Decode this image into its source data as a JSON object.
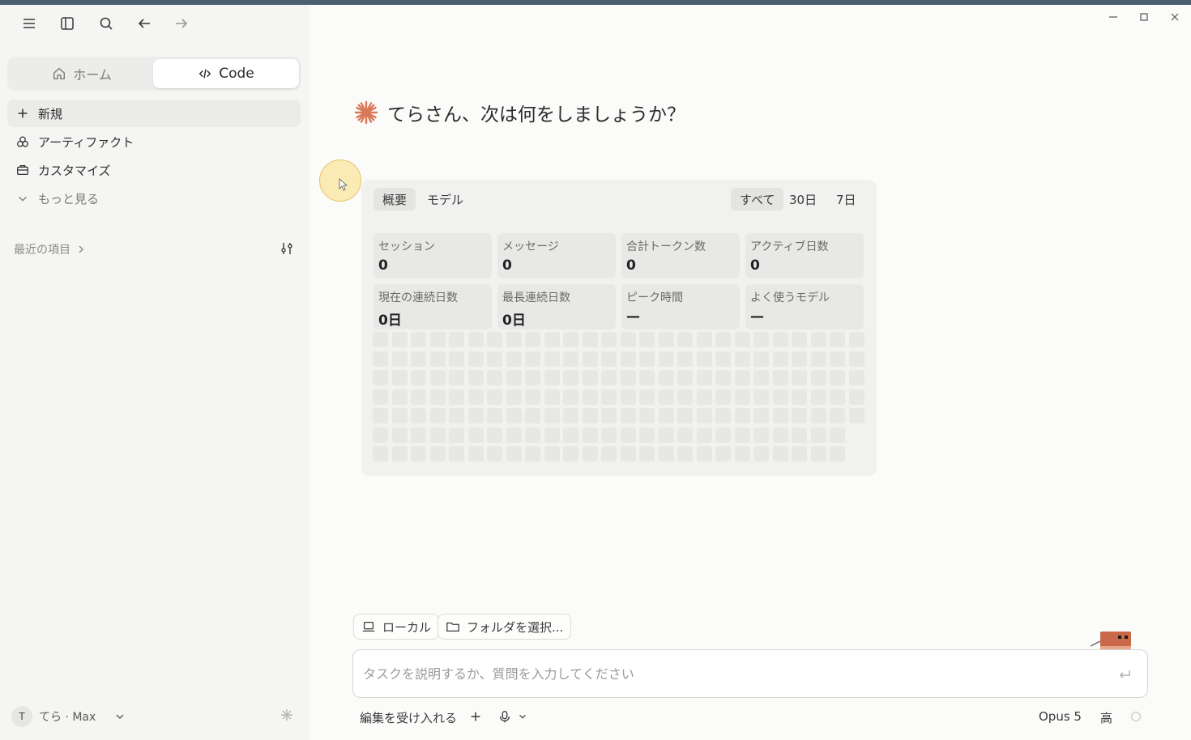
{
  "sidebar": {
    "mode_tabs": {
      "home": "ホーム",
      "code": "Code"
    },
    "nav": {
      "new": "新規",
      "artifacts": "アーティファクト",
      "customize": "カスタマイズ",
      "more": "もっと見る"
    },
    "recent_label": "最近の項目",
    "user": {
      "initial": "T",
      "name": "てら · Max"
    }
  },
  "main": {
    "greeting": "てらさん、次は何をしましょうか？",
    "stats": {
      "tabs": {
        "overview": "概要",
        "model": "モデル"
      },
      "ranges": {
        "all": "すべて",
        "d30": "30日",
        "d7": "7日"
      },
      "boxes": [
        {
          "label": "セッション",
          "value": "0"
        },
        {
          "label": "メッセージ",
          "value": "0"
        },
        {
          "label": "合計トークン数",
          "value": "0"
        },
        {
          "label": "アクティブ日数",
          "value": "0"
        },
        {
          "label": "現在の連続日数",
          "value": "0日"
        },
        {
          "label": "最長連続日数",
          "value": "0日"
        },
        {
          "label": "ピーク時間",
          "value": "—"
        },
        {
          "label": "よく使うモデル",
          "value": "—"
        }
      ]
    },
    "env_pills": {
      "local": "ローカル",
      "folder": "フォルダを選択..."
    },
    "input": {
      "placeholder": "タスクを説明するか、質問を入力してください"
    },
    "bottom": {
      "accept_edits": "編集を受け入れる",
      "model": "Opus 5",
      "effort": "高"
    }
  },
  "colors": {
    "accent": "#d97757",
    "titlebar": "#4d6070"
  }
}
